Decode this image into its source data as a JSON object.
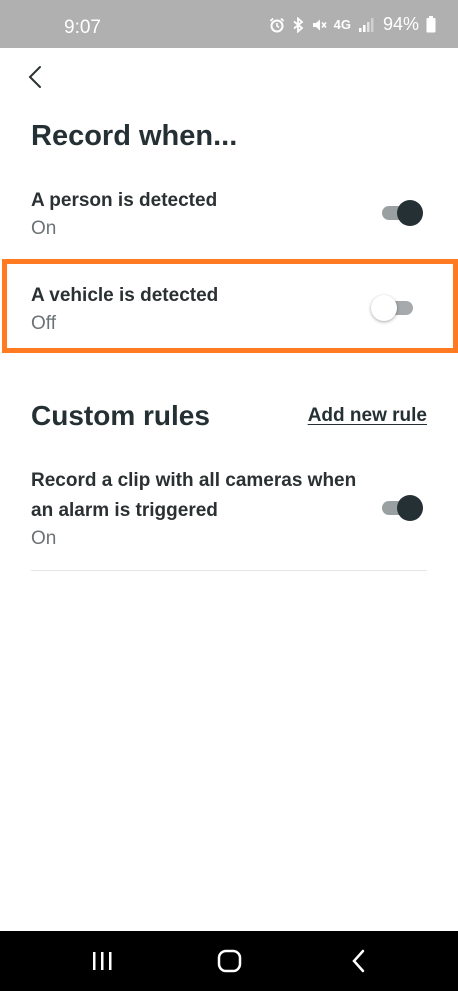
{
  "status_bar": {
    "time": "9:07",
    "network": "4G",
    "battery_percent": "94%",
    "icons": [
      "alarm-icon",
      "bluetooth-icon",
      "mute-icon",
      "signal-icon",
      "battery-icon"
    ]
  },
  "header": {
    "back_icon": "chevron-left-icon",
    "title": "Record when..."
  },
  "record_when": [
    {
      "label": "A person is detected",
      "status": "On",
      "enabled": true
    },
    {
      "label": "A vehicle is detected",
      "status": "Off",
      "enabled": false
    }
  ],
  "custom_rules": {
    "title": "Custom rules",
    "add_link": "Add new rule",
    "rules": [
      {
        "label": "Record a clip with all cameras when an alarm is triggered",
        "status": "On",
        "enabled": true
      }
    ]
  },
  "highlight_color": "#ff7a20",
  "nav_bar": {
    "icons": [
      "recent-apps-icon",
      "home-icon",
      "back-icon"
    ]
  }
}
